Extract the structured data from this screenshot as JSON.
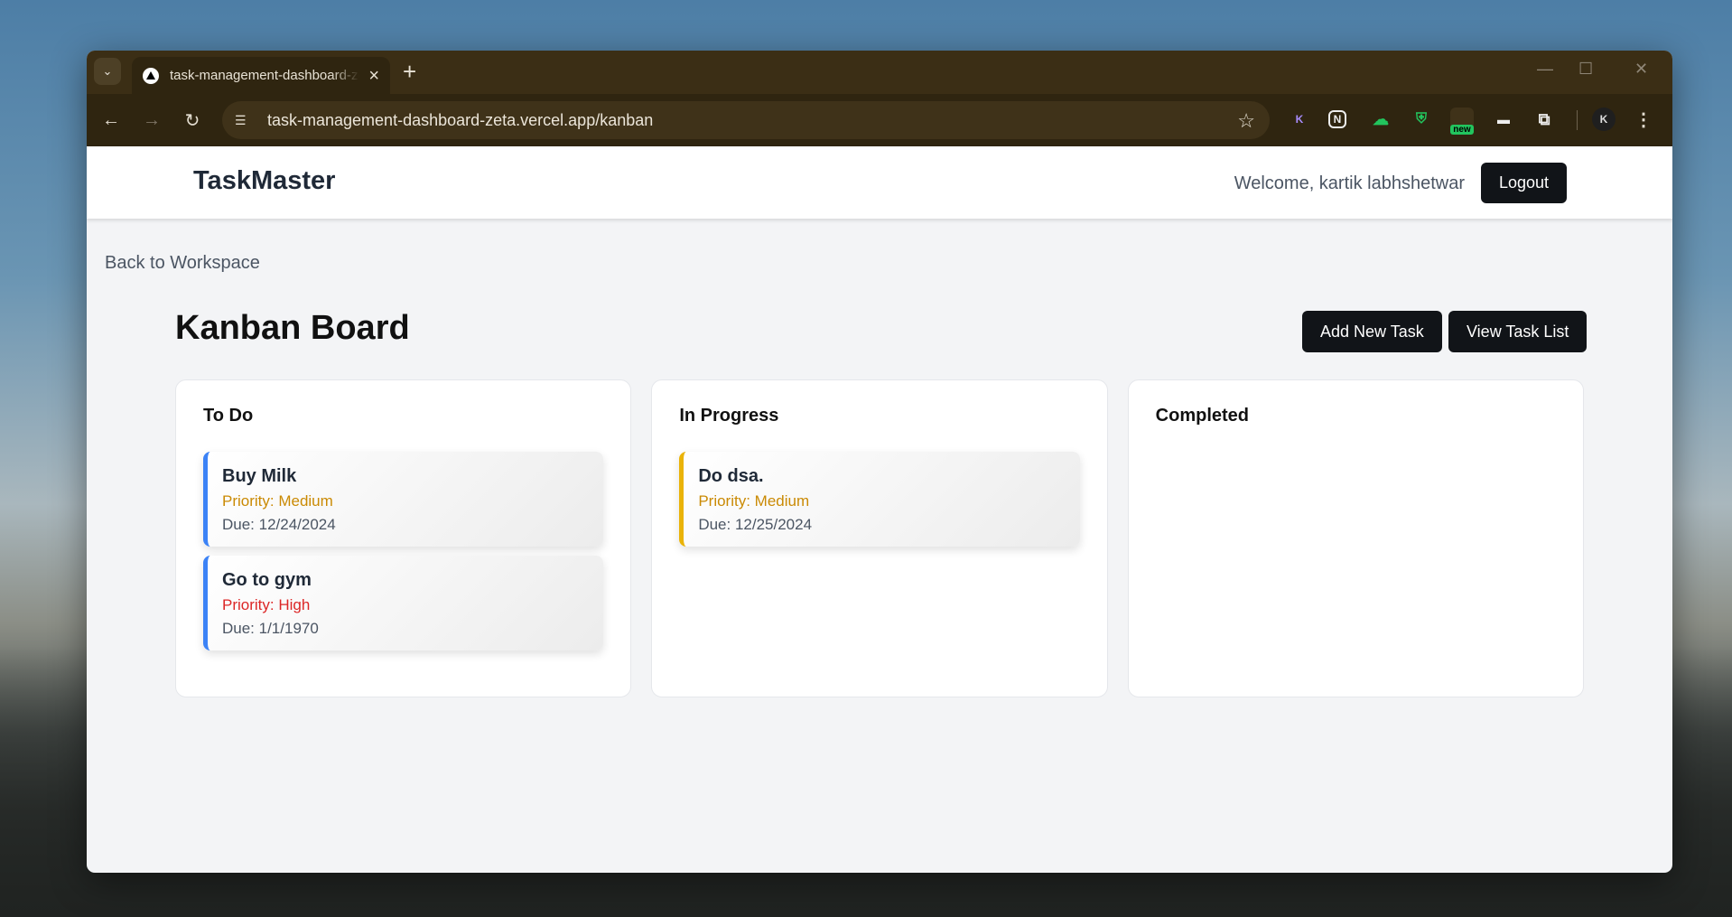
{
  "browser": {
    "tab_title": "task-management-dashboard-zeta.vercel.app/kanban",
    "url": "task-management-dashboard-zeta.vercel.app/kanban",
    "new_tab_glyph": "+",
    "extension_new_badge": "new"
  },
  "app": {
    "brand": "TaskMaster",
    "welcome": "Welcome, kartik labhshetwar",
    "logout_label": "Logout",
    "back_label": "Back to Workspace",
    "page_title": "Kanban Board",
    "add_task_label": "Add New Task",
    "view_list_label": "View Task List"
  },
  "colors": {
    "accent_dark": "#111418",
    "priority_medium": "#ca8a04",
    "priority_high": "#dc2626",
    "todo_border": "#3b82f6",
    "inprogress_border": "#eab308"
  },
  "columns": [
    {
      "title": "To Do",
      "cards": [
        {
          "title": "Buy Milk",
          "priority": "Priority: Medium",
          "due": "Due: 12/24/2024"
        },
        {
          "title": "Go to gym",
          "priority": "Priority: High",
          "due": "Due: 1/1/1970"
        }
      ]
    },
    {
      "title": "In Progress",
      "cards": [
        {
          "title": "Do dsa.",
          "priority": "Priority: Medium",
          "due": "Due: 12/25/2024"
        }
      ]
    },
    {
      "title": "Completed",
      "cards": []
    }
  ]
}
